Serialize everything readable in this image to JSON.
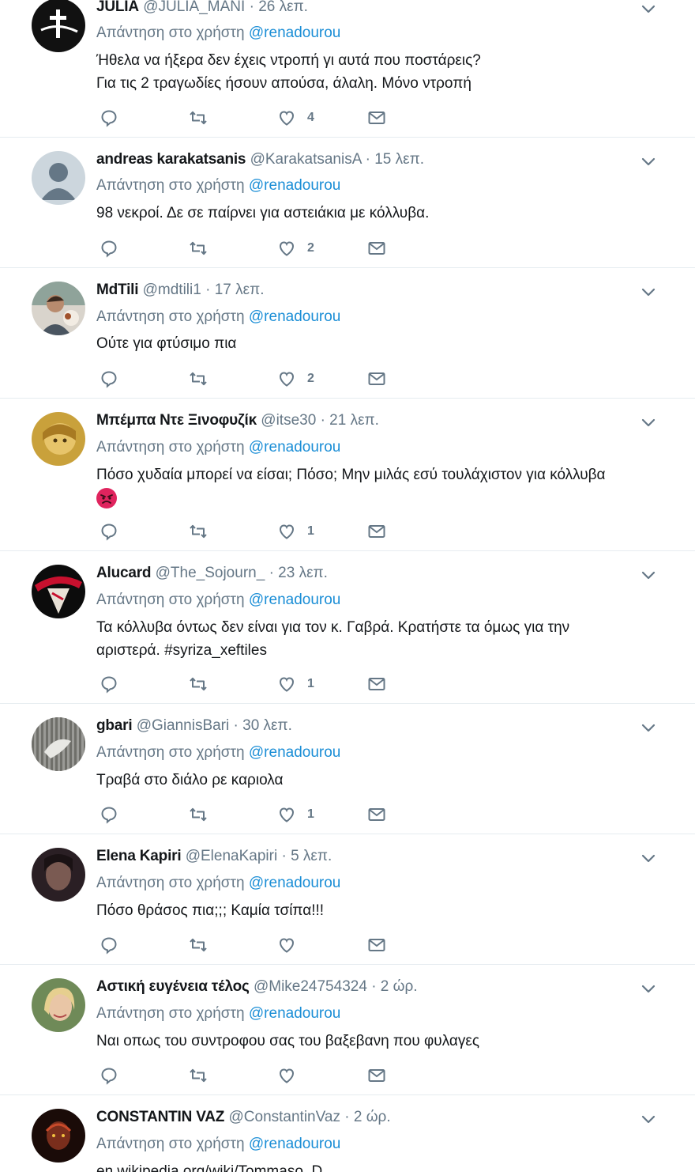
{
  "reply_prefix": "Απάντηση στο χρήστη",
  "reply_mention": "@renadourou",
  "dot": "·",
  "tweets": [
    {
      "name": "JULIA",
      "handle": "@JULIA_MANI",
      "time": "26 λεπ.",
      "lines": [
        "Ήθελα να ήξερα δεν έχεις ντροπή γι αυτά που ποστάρεις?",
        "Για τις 2 τραγωδίες ήσουν απούσα, άλαλη. Μόνο ντροπή"
      ],
      "likes": "4",
      "avatar": "julia"
    },
    {
      "name": "andreas karakatsanis",
      "handle": "@KarakatsanisA",
      "time": "15 λεπ.",
      "lines": [
        "98 νεκροί. Δε σε παίρνει για αστειάκια με κόλλυβα."
      ],
      "likes": "2",
      "avatar": "default"
    },
    {
      "name": "MdTili",
      "handle": "@mdtili1",
      "time": "17 λεπ.",
      "lines": [
        "Ούτε για φτύσιμο πια"
      ],
      "likes": "2",
      "avatar": "mdtili"
    },
    {
      "name": "Μπέμπα Ντε Ξινοφυζίκ",
      "handle": "@itse30",
      "time": "21 λεπ.",
      "lines": [
        "Πόσο χυδαία μπορεί να είσαι; Πόσο; Μην μιλάς εσύ τουλάχιστον για κόλλυβα"
      ],
      "emoji": "angry-face-emoji",
      "likes": "1",
      "avatar": "bebe"
    },
    {
      "name": "Alucard",
      "handle": "@The_Sojourn_",
      "time": "23 λεπ.",
      "lines": [
        "Τα κόλλυβα όντως δεν είναι για τον κ. Γαβρά. Κρατήστε τα όμως για την",
        "αριστερά. #syriza_xeftiles"
      ],
      "likes": "1",
      "avatar": "alucard"
    },
    {
      "name": "gbari",
      "handle": "@GiannisBari",
      "time": "30 λεπ.",
      "lines": [
        "Τραβά στο διάλο ρε καριολα"
      ],
      "likes": "1",
      "avatar": "gbari"
    },
    {
      "name": "Elena Kapiri",
      "handle": "@ElenaKapiri",
      "time": "5 λεπ.",
      "lines": [
        "Πόσο θράσος πια;;; Καμία τσίπα!!!"
      ],
      "likes": "",
      "avatar": "elena"
    },
    {
      "name": "Αστική ευγένεια τέλος",
      "handle": "@Mike24754324",
      "time": "2 ώρ.",
      "lines": [
        "Ναι οπως του συντροφου σας του βαξεβανη που φυλαγες"
      ],
      "likes": "",
      "avatar": "astiki"
    },
    {
      "name": "CONSTANTIN VAZ",
      "handle": "@ConstantinVaz",
      "time": "2 ώρ.",
      "lines": [
        "en.wikipedia.org/wiki/Tommaso_D..."
      ],
      "likes": "",
      "avatar": "constantin"
    }
  ],
  "icons": {
    "reply": "reply-bubble-icon",
    "retweet": "retweet-icon",
    "like": "heart-icon",
    "dm": "envelope-icon",
    "caret": "chevron-down-icon"
  }
}
